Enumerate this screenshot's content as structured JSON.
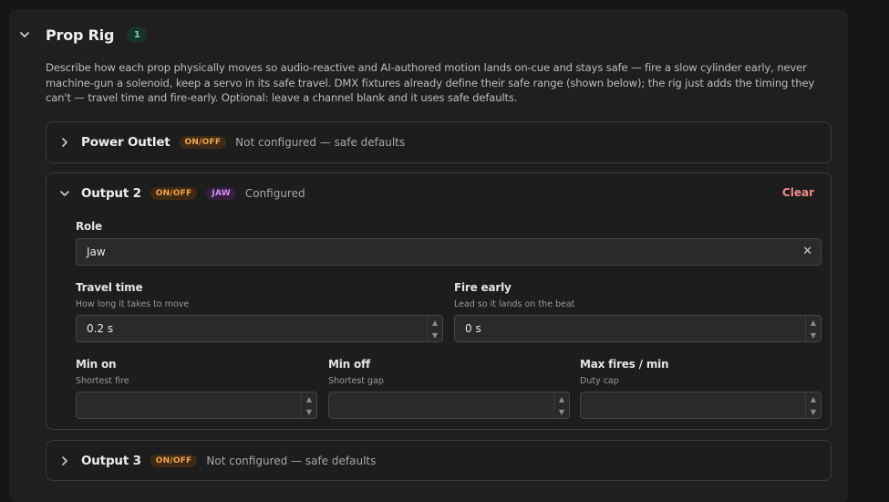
{
  "section": {
    "title": "Prop Rig",
    "count": "1",
    "description": "Describe how each prop physically moves so audio-reactive and AI-authored motion lands on-cue and stays safe — fire a slow cylinder early, never machine-gun a solenoid, keep a servo in its safe travel. DMX fixtures already define their safe range (shown below); the rig just adds the timing they can't — travel time and fire-early. Optional: leave a channel blank and it uses safe defaults."
  },
  "channels": [
    {
      "name": "Power Outlet",
      "type_tag": "ON/OFF",
      "status": "Not configured — safe defaults"
    },
    {
      "name": "Output 2",
      "type_tag": "ON/OFF",
      "role_tag": "JAW",
      "status": "Configured",
      "clear_label": "Clear",
      "role": {
        "label": "Role",
        "value": "Jaw"
      },
      "travel_time": {
        "label": "Travel time",
        "hint": "How long it takes to move",
        "value": "0.2 s"
      },
      "fire_early": {
        "label": "Fire early",
        "hint": "Lead so it lands on the beat",
        "value": "0 s"
      },
      "min_on": {
        "label": "Min on",
        "hint": "Shortest fire",
        "value": ""
      },
      "min_off": {
        "label": "Min off",
        "hint": "Shortest gap",
        "value": ""
      },
      "max_fires": {
        "label": "Max fires / min",
        "hint": "Duty cap",
        "value": ""
      }
    },
    {
      "name": "Output 3",
      "type_tag": "ON/OFF",
      "status": "Not configured — safe defaults"
    }
  ],
  "icons": {
    "expanded": "chevron-down-icon",
    "collapsed": "chevron-right-icon",
    "clear_field": "close-icon",
    "stepper_up": "caret-up-icon",
    "stepper_down": "caret-down-icon"
  },
  "colors": {
    "onoff_tag": "#f3a552",
    "jaw_tag": "#d390ef",
    "count_badge": "#7fd9a6",
    "clear_action": "#f08a8a"
  }
}
